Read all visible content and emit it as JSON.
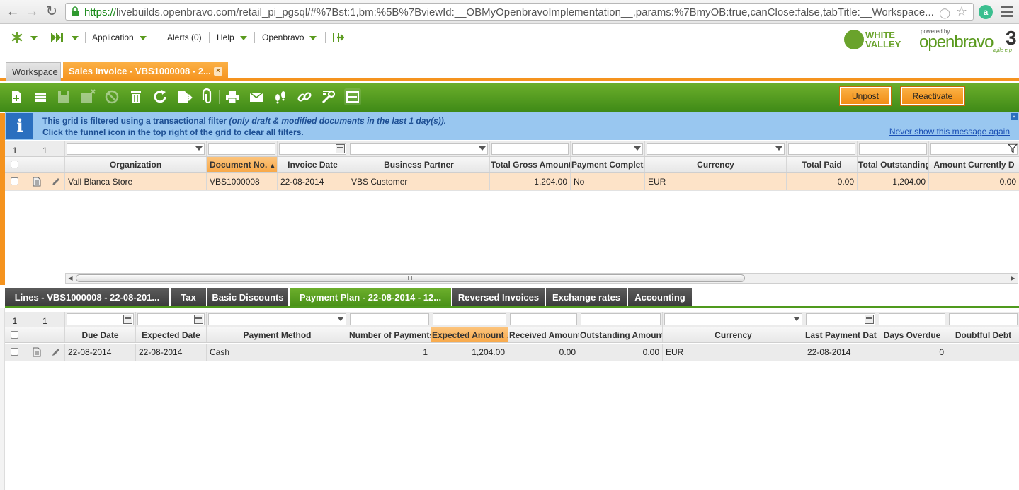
{
  "browser": {
    "url_scheme": "https://",
    "url_rest": "livebuilds.openbravo.com/retail_pi_pgsql/#%7Bst:1,bm:%5B%7BviewId:__OBMyOpenbravoImplementation__,params:%7BmyOB:true,canClose:false,tabTitle:__Workspace..."
  },
  "nav": {
    "application": "Application",
    "alerts": "Alerts (0)",
    "help": "Help",
    "openbravo": "Openbravo"
  },
  "logos": {
    "wv_line1": "WHITE",
    "wv_line2": "VALLEY",
    "powered_by": "powered by",
    "ob_name": "openbravo",
    "ob_version": "3",
    "ob_tagline": "agile erp"
  },
  "window_tabs": {
    "workspace": "Workspace",
    "active": "Sales Invoice - VBS1000008 - 2...",
    "close": "×"
  },
  "toolbar": {
    "unpost": "Unpost",
    "reactivate": "Reactivate"
  },
  "info": {
    "line1_bold": "This grid is filtered using a transactional filter ",
    "line1_italic": "(only draft & modified documents in the last 1 day(s)).",
    "line2": "Click the funnel icon in the top right of the grid to clear all filters.",
    "link": "Never show this message again"
  },
  "grid_top": {
    "count_a": "1",
    "count_b": "1",
    "headers": [
      "Organization",
      "Document No.",
      "Invoice Date",
      "Business Partner",
      "Total Gross Amount",
      "Payment Complete",
      "Currency",
      "Total Paid",
      "Total Outstanding",
      "Amount Currently D"
    ],
    "sort_arrow": "▲",
    "rows": [
      [
        "Vall Blanca Store",
        "VBS1000008",
        "22-08-2014",
        "VBS Customer",
        "1,204.00",
        "No",
        "EUR",
        "0.00",
        "1,204.00",
        "0.00"
      ]
    ]
  },
  "child_tabs": [
    "Lines - VBS1000008 - 22-08-201...",
    "Tax",
    "Basic Discounts",
    "Payment Plan - 22-08-2014 - 12...",
    "Reversed Invoices",
    "Exchange rates",
    "Accounting"
  ],
  "grid_bottom": {
    "count_a": "1",
    "count_b": "1",
    "headers": [
      "Due Date",
      "Expected Date",
      "Payment Method",
      "Number of Payments",
      "Expected Amount",
      "Received Amount",
      "Outstanding Amount",
      "Currency",
      "Last Payment Date",
      "Days Overdue",
      "Doubtful Debt"
    ],
    "sort_arrow": "▲",
    "rows": [
      [
        "22-08-2014",
        "22-08-2014",
        "Cash",
        "1",
        "1,204.00",
        "0.00",
        "0.00",
        "EUR",
        "22-08-2014",
        "0",
        ""
      ]
    ]
  },
  "colors": {
    "green_toolbar": "#4f9a1d",
    "orange_accent": "#f5931e",
    "info_blue": "#99c7f0",
    "row_highlight": "#fde3c8"
  }
}
